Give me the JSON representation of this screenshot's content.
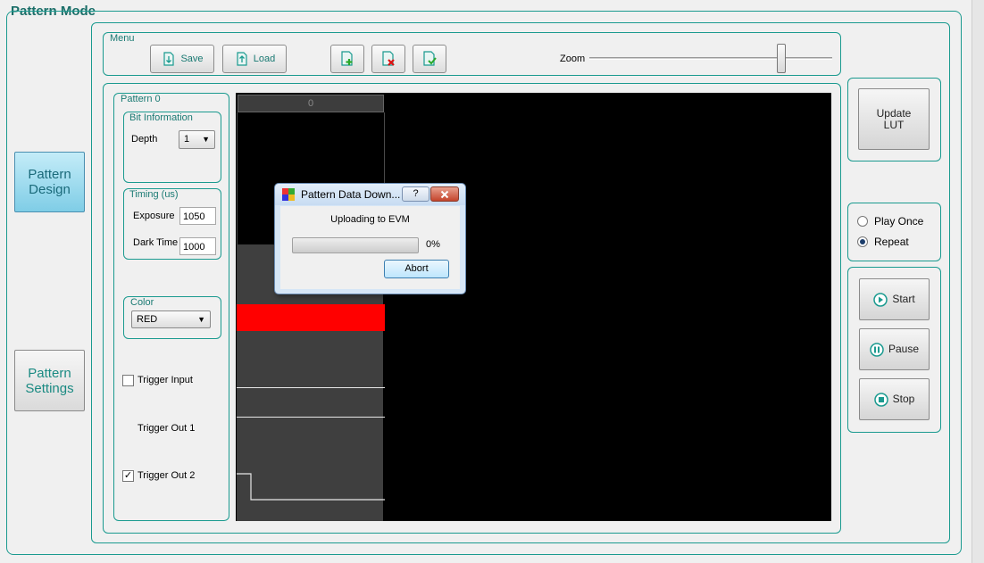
{
  "page": {
    "title": "Pattern Mode"
  },
  "nav": {
    "pattern_design": "Pattern\nDesign",
    "pattern_settings": "Pattern\nSettings"
  },
  "menu": {
    "label": "Menu",
    "save": "Save",
    "load": "Load",
    "zoom_label": "Zoom",
    "zoom_level": 0.8
  },
  "pattern": {
    "group_label": "Pattern 0",
    "bit_info_label": "Bit Information",
    "depth_label": "Depth",
    "depth_value": "1",
    "timing_label": "Timing (us)",
    "exposure_label": "Exposure",
    "exposure_value": "1050",
    "dark_time_label": "Dark Time",
    "dark_time_value": "1000",
    "color_label": "Color",
    "color_value": "RED",
    "trigger_input_label": "Trigger Input",
    "trigger_input_checked": false,
    "trigger_out1_label": "Trigger Out 1",
    "trigger_out2_label": "Trigger Out 2",
    "trigger_out2_checked": true
  },
  "timeline": {
    "header": "0",
    "color": "#ff0000"
  },
  "right": {
    "update_lut": "Update\nLUT",
    "play_once": "Play Once",
    "repeat": "Repeat",
    "selected": "repeat",
    "start": "Start",
    "pause": "Pause",
    "stop": "Stop"
  },
  "dialog": {
    "title": "Pattern Data Down...",
    "help": "?",
    "message": "Uploading to EVM",
    "progress": 0,
    "progress_text": "0%",
    "abort": "Abort"
  },
  "colors": {
    "accent": "#1a9a8f",
    "canvas": "#000000",
    "pattern_bg": "#3f3f3f"
  }
}
